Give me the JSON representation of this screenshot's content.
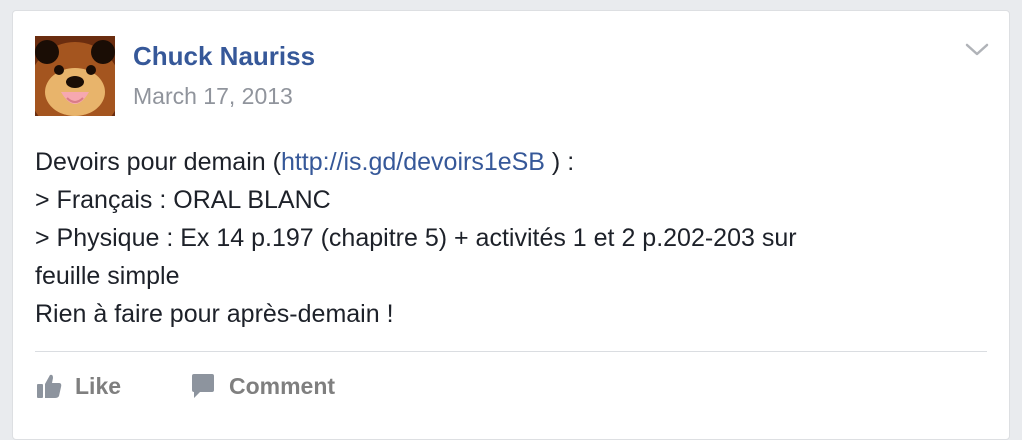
{
  "post": {
    "author": "Chuck Nauriss",
    "date": "March 17, 2013",
    "body": {
      "intro_before_link": "Devoirs pour demain (",
      "link_text": "http://is.gd/devoirs1eSB",
      "intro_after_link": " ) :",
      "line2": "> Français : ORAL BLANC",
      "line3": "> Physique : Ex 14 p.197 (chapitre 5) + activités 1 et 2 p.202-203 sur",
      "line4": "feuille simple",
      "line5": "Rien à faire pour après-demain !"
    }
  },
  "actions": {
    "like_label": "Like",
    "comment_label": "Comment"
  },
  "icons": {
    "menu": "chevron-down-icon",
    "like": "thumbs-up-icon",
    "comment": "speech-bubble-icon"
  },
  "colors": {
    "link": "#365899",
    "meta": "#90949c",
    "text": "#1d2129",
    "action": "#7f7f7f",
    "background": "#e9ebee"
  }
}
